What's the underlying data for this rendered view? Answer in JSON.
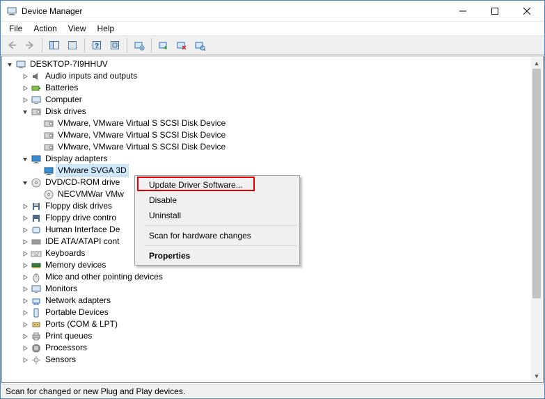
{
  "window": {
    "title": "Device Manager"
  },
  "menubar": {
    "items": [
      "File",
      "Action",
      "View",
      "Help"
    ]
  },
  "toolbar": {
    "buttons": [
      {
        "name": "back",
        "enabled": false
      },
      {
        "name": "forward",
        "enabled": false
      },
      {
        "name": "sep"
      },
      {
        "name": "show-hide-console-tree",
        "enabled": true
      },
      {
        "name": "properties",
        "enabled": true
      },
      {
        "name": "sep"
      },
      {
        "name": "help",
        "enabled": true
      },
      {
        "name": "show-hidden-devices",
        "enabled": true
      },
      {
        "name": "sep"
      },
      {
        "name": "update-driver",
        "enabled": true
      },
      {
        "name": "sep"
      },
      {
        "name": "uninstall",
        "enabled": true
      },
      {
        "name": "disable",
        "enabled": true
      },
      {
        "name": "scan-for-hardware-changes",
        "enabled": true
      }
    ]
  },
  "tree": {
    "root": {
      "label": "DESKTOP-7I9HHUV",
      "expanded": true,
      "icon": "computer-icon"
    },
    "items": [
      {
        "label": "Audio inputs and outputs",
        "icon": "audio-icon",
        "twisty": "closed",
        "indent": 1
      },
      {
        "label": "Batteries",
        "icon": "battery-icon",
        "twisty": "closed",
        "indent": 1
      },
      {
        "label": "Computer",
        "icon": "computer-icon",
        "twisty": "closed",
        "indent": 1
      },
      {
        "label": "Disk drives",
        "icon": "disk-icon",
        "twisty": "open",
        "indent": 1
      },
      {
        "label": "VMware, VMware Virtual S SCSI Disk Device",
        "icon": "disk-icon",
        "twisty": "none",
        "indent": 2
      },
      {
        "label": "VMware, VMware Virtual S SCSI Disk Device",
        "icon": "disk-icon",
        "twisty": "none",
        "indent": 2
      },
      {
        "label": "VMware, VMware Virtual S SCSI Disk Device",
        "icon": "disk-icon",
        "twisty": "none",
        "indent": 2
      },
      {
        "label": "Display adapters",
        "icon": "display-icon",
        "twisty": "open",
        "indent": 1
      },
      {
        "label": "VMware SVGA 3D",
        "icon": "display-icon",
        "twisty": "none",
        "indent": 2,
        "selected": true
      },
      {
        "label": "DVD/CD-ROM drive",
        "icon": "optical-icon",
        "twisty": "open",
        "indent": 1,
        "truncated": true
      },
      {
        "label": "NECVMWar VMw",
        "icon": "optical-icon",
        "twisty": "none",
        "indent": 2,
        "truncated": true
      },
      {
        "label": "Floppy disk drives",
        "icon": "floppy-icon",
        "twisty": "closed",
        "indent": 1
      },
      {
        "label": "Floppy drive contro",
        "icon": "floppy-controller-icon",
        "twisty": "closed",
        "indent": 1,
        "truncated": true
      },
      {
        "label": "Human Interface De",
        "icon": "hid-icon",
        "twisty": "closed",
        "indent": 1,
        "truncated": true
      },
      {
        "label": "IDE ATA/ATAPI cont",
        "icon": "ide-icon",
        "twisty": "closed",
        "indent": 1,
        "truncated": true
      },
      {
        "label": "Keyboards",
        "icon": "keyboard-icon",
        "twisty": "closed",
        "indent": 1
      },
      {
        "label": "Memory devices",
        "icon": "memory-icon",
        "twisty": "closed",
        "indent": 1
      },
      {
        "label": "Mice and other pointing devices",
        "icon": "mouse-icon",
        "twisty": "closed",
        "indent": 1
      },
      {
        "label": "Monitors",
        "icon": "monitor-icon",
        "twisty": "closed",
        "indent": 1
      },
      {
        "label": "Network adapters",
        "icon": "network-icon",
        "twisty": "closed",
        "indent": 1
      },
      {
        "label": "Portable Devices",
        "icon": "portable-icon",
        "twisty": "closed",
        "indent": 1
      },
      {
        "label": "Ports (COM & LPT)",
        "icon": "port-icon",
        "twisty": "closed",
        "indent": 1
      },
      {
        "label": "Print queues",
        "icon": "printer-icon",
        "twisty": "closed",
        "indent": 1
      },
      {
        "label": "Processors",
        "icon": "processor-icon",
        "twisty": "closed",
        "indent": 1
      },
      {
        "label": "Sensors",
        "icon": "sensor-icon",
        "twisty": "closed",
        "indent": 1,
        "cutoff": true
      }
    ]
  },
  "context_menu": {
    "items": [
      {
        "label": "Update Driver Software...",
        "highlighted": true
      },
      {
        "label": "Disable"
      },
      {
        "label": "Uninstall"
      },
      {
        "sep": true
      },
      {
        "label": "Scan for hardware changes"
      },
      {
        "sep": true
      },
      {
        "label": "Properties",
        "bold": true
      }
    ]
  },
  "statusbar": {
    "text": "Scan for changed or new Plug and Play devices."
  }
}
